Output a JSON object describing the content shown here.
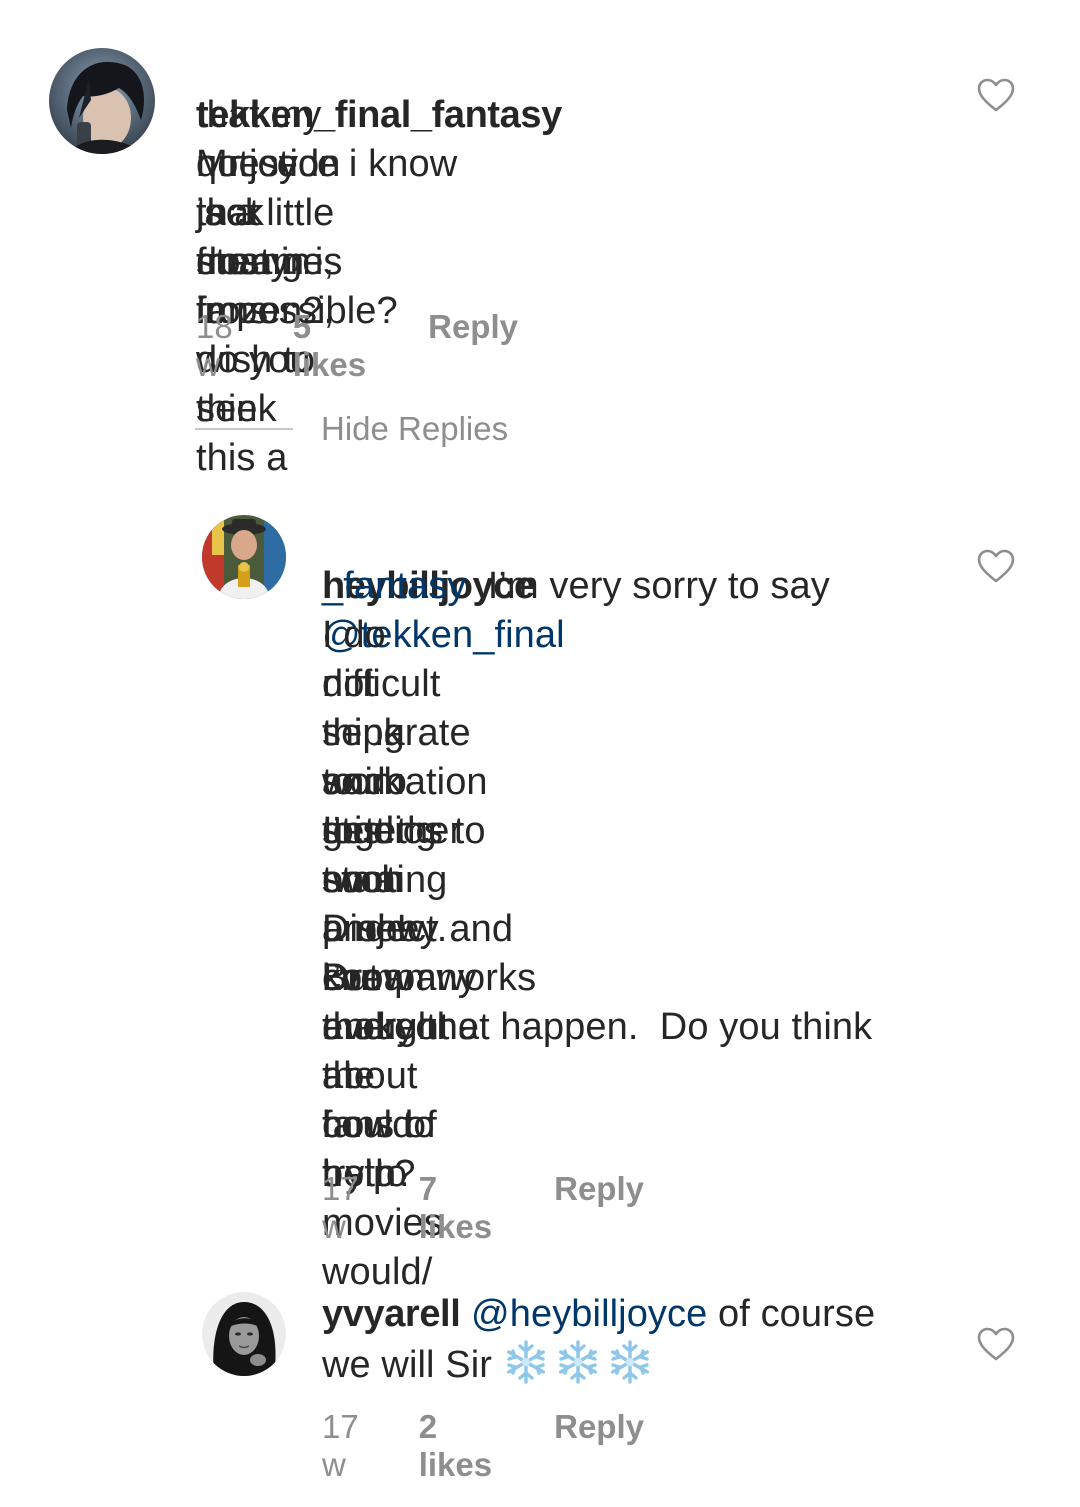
{
  "comments": [
    {
      "username": "tekken_final_fantasy",
      "text": "Mr.joyce i know",
      "lines": [
        "that my question is a little strange, i",
        "noticed that many fans wish to see",
        "jack frost in frozen2, do you think this a",
        "dream is impossible?"
      ],
      "time": "18 w",
      "likes": "5 likes",
      "reply": "Reply",
      "avatar_icon": "dark-haired-character-avatar",
      "heart_icon": "heart-outline-icon"
    }
  ],
  "hide_replies_label": "Hide Replies",
  "replies": [
    {
      "username": "heybilljoyce",
      "mention_part1": "@tekken_final",
      "mention_part2": "_fantasy",
      "first_line_tail": "  I’m very sorry to say",
      "lines": [
        "I do not think so. It is such a",
        "difficult thing to do getting two",
        "separate animation studios to",
        "work together on a project. But",
        "I’m starting a new company",
        "soon and I know everyone at",
        "Disney and Dreamworks and",
        "I’ve thought about how to try to",
        "make that happen.  Do you think",
        "the fans of both movies would/",
        "could help?"
      ],
      "time": "17 w",
      "likes": "7 likes",
      "reply": "Reply",
      "avatar_icon": "man-with-hat-avatar",
      "heart_icon": "heart-outline-icon"
    },
    {
      "username": "yvyarell",
      "mention": "@heybilljoyce",
      "text_tail": " of course",
      "line2": "we will Sir",
      "emoji": [
        "snowflake-emoji",
        "snowflake-emoji",
        "snowflake-emoji"
      ],
      "time": "17 w",
      "likes": "2 likes",
      "reply": "Reply",
      "avatar_icon": "woman-portrait-avatar",
      "heart_icon": "heart-outline-icon"
    }
  ],
  "colors": {
    "text": "#262626",
    "mention": "#00376b",
    "meta": "#8e8e8e",
    "divider": "#c7c7c7"
  }
}
